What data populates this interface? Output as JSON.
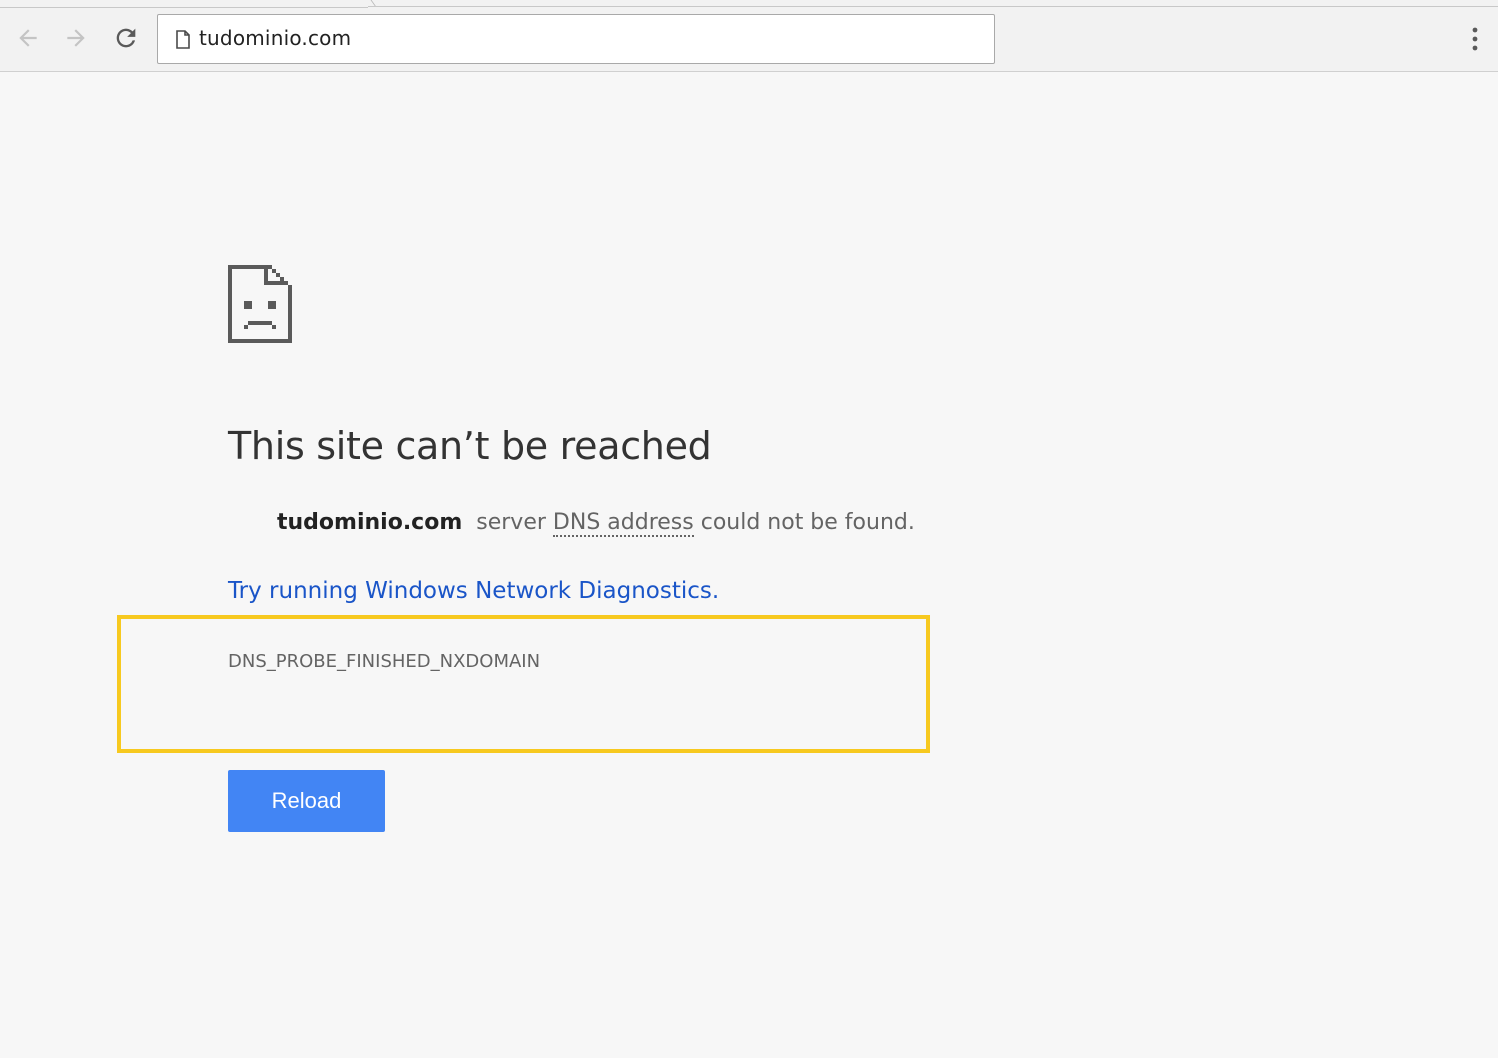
{
  "browser": {
    "url": "tudominio.com",
    "icons": {
      "back": "back-arrow-icon",
      "forward": "forward-arrow-icon",
      "reload": "reload-icon",
      "page": "page-icon",
      "menu": "more-vert-icon"
    }
  },
  "error_page": {
    "icon": "sad-document-icon",
    "heading": "This site can’t be reached",
    "summary": {
      "domain": "tudominio.com",
      "text_before": "server",
      "dns": "DNS address",
      "text_after": "could not be found."
    },
    "suggestion_link": "Try running Windows Network Diagnostics.",
    "error_code": "DNS_PROBE_FINISHED_NXDOMAIN",
    "reload_label": "Reload"
  },
  "colors": {
    "background": "#f7f7f7",
    "link": "#1a55c8",
    "button": "#4285f4",
    "highlight": "#f7c91f"
  }
}
